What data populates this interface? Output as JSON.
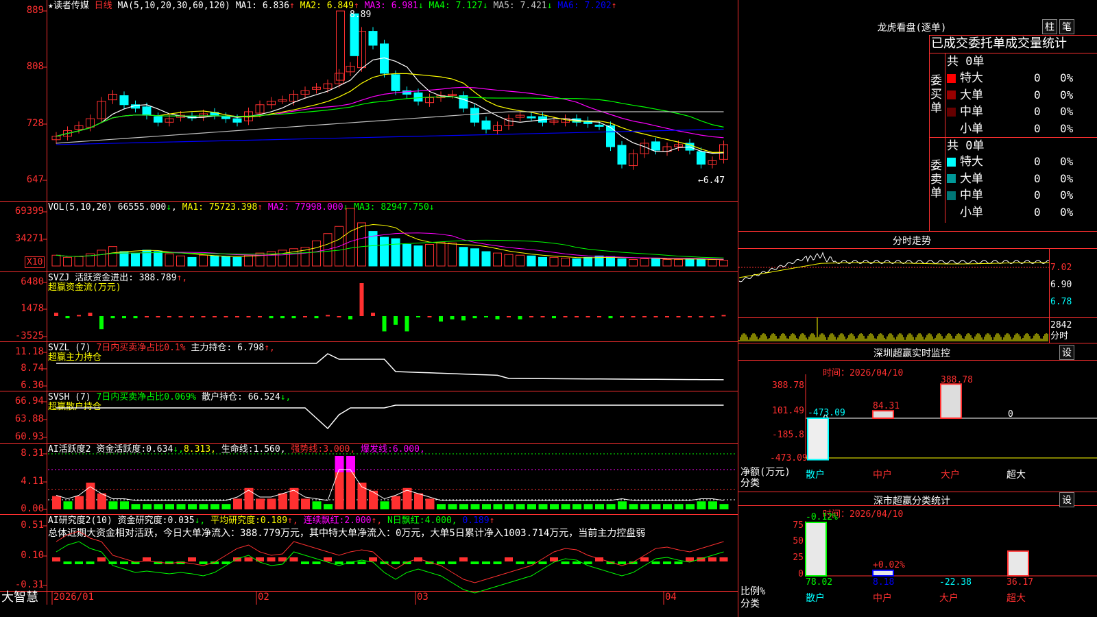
{
  "main": {
    "title": "★读者传媒",
    "period": "日线",
    "ma_label": "MA(5,10,20,30,60,120)",
    "ma": [
      {
        "label": "MA1:",
        "value": "6.836",
        "arrow": "↑",
        "color": "#ffffff"
      },
      {
        "label": "MA2:",
        "value": "6.849",
        "arrow": "↑",
        "color": "#ffff00"
      },
      {
        "label": "MA3:",
        "value": "6.981",
        "arrow": "↓",
        "color": "#ff00ff"
      },
      {
        "label": "MA4:",
        "value": "7.127",
        "arrow": "↓",
        "color": "#00ff00"
      },
      {
        "label": "MA5:",
        "value": "7.421",
        "arrow": "↓",
        "color": "#c0c0c0"
      },
      {
        "label": "MA6:",
        "value": "7.202",
        "arrow": "↑",
        "color": "#0000ff"
      }
    ],
    "yaxis": [
      "889",
      "808",
      "728",
      "647"
    ],
    "high_note": "8.89",
    "low_note": "←6.47"
  },
  "vol": {
    "label": "VOL(5,10,20)",
    "v0": "66555.000",
    "v0_arrow": "↓",
    "ma": [
      {
        "label": "MA1:",
        "value": "75723.398",
        "arrow": "↑",
        "color": "#ffff00"
      },
      {
        "label": "MA2:",
        "value": "77998.000",
        "arrow": "↓",
        "color": "#ff00ff"
      },
      {
        "label": "MA3:",
        "value": "82947.750",
        "arrow": "↓",
        "color": "#00ff00"
      }
    ],
    "yaxis": [
      "69399",
      "34271"
    ],
    "unit": "X10"
  },
  "svzj": {
    "label": "SVZJ",
    "line1": "活跃资金进出:",
    "val1": "388.789",
    "arrow1": "↑,",
    "line2": "超赢资金流(万元)",
    "yaxis": [
      "6480",
      "1478",
      "-3525"
    ]
  },
  "svzl": {
    "label": "SVZL (7)",
    "desc": "7日内买卖净占比0.1%",
    "line1": "主力持仓:",
    "val1": "6.798",
    "arrow1": "↑,",
    "line2": "超赢主力持仓",
    "yaxis": [
      "11.18",
      "8.74",
      "6.30"
    ]
  },
  "svsh": {
    "label": "SVSH (7)",
    "desc": "7日内买卖净占比0.069%",
    "line1": "散户持仓:",
    "val1": "66.524",
    "arrow1": "↓,",
    "line2": "超赢散户持仓",
    "yaxis": [
      "66.94",
      "63.88",
      "60.93"
    ]
  },
  "ai1": {
    "label": "AI活跃度2",
    "p1": "资金活跃度:",
    "v1": "0.634",
    "a1": "↓,",
    "v2": "8.313,",
    "p3": "生命线:",
    "v3": "1.560,",
    "p4": "强势线:",
    "v4": "3.000,",
    "p5": "爆发线:",
    "v5": "6.000,",
    "yaxis": [
      "8.31",
      "4.11",
      "0.00"
    ]
  },
  "ai2": {
    "label": "AI研究度2(10)",
    "p1": "资金研究度:",
    "v1": "0.035",
    "a1": "↓,",
    "p2": "平均研究度:",
    "v2": "0.189",
    "a2": "↑,",
    "p3": "连续飘红:",
    "v3": "2.000",
    "a3": "↑,",
    "p4": "N日飘红:",
    "v4": "4.000,",
    "v5": "0.189",
    "a5": "↑",
    "summary": "总体近期大资金相对活跃，今日大单净流入：388.779万元，其中特大单净流入：0万元，大单5日累计净入1003.714万元，当前主力控盘弱",
    "yaxis": [
      "0.51",
      "0.10",
      "-0.31"
    ]
  },
  "bottom": {
    "brand": "大智慧",
    "dates": [
      "2026/01",
      "02",
      "03",
      "04"
    ]
  },
  "lhkp": {
    "title": "龙虎看盘(逐单)",
    "btn1": "柱",
    "btn2": "笔",
    "subtitle": "已成交委托单成交量统计",
    "buy_label": "委买单",
    "sell_label": "委卖单",
    "buy_total": "共 0单",
    "sell_total": "共 0单",
    "buy_rows": [
      {
        "name": "特大",
        "n": "0",
        "p": "0%",
        "color": "#ff0000"
      },
      {
        "name": "大单",
        "n": "0",
        "p": "0%",
        "color": "#990000"
      },
      {
        "name": "中单",
        "n": "0",
        "p": "0%",
        "color": "#660000"
      },
      {
        "name": "小单",
        "n": "0",
        "p": "0%",
        "color": ""
      }
    ],
    "sell_rows": [
      {
        "name": "特大",
        "n": "0",
        "p": "0%",
        "color": "#00ffff"
      },
      {
        "name": "大单",
        "n": "0",
        "p": "0%",
        "color": "#009999"
      },
      {
        "name": "中单",
        "n": "0",
        "p": "0%",
        "color": "#007777"
      },
      {
        "name": "小单",
        "n": "0",
        "p": "0%",
        "color": ""
      }
    ]
  },
  "fenshi": {
    "title": "分时走势",
    "yaxis": [
      "7.02",
      "6.90",
      "6.78"
    ],
    "vol_top": "2842",
    "vol_unit": "分时"
  },
  "sz_monitor": {
    "title": "深圳超赢实时监控",
    "btn": "设",
    "time_label": "时间：2026/04/10",
    "yaxis": [
      "388.78",
      "101.49",
      "0",
      "-185.8",
      "-473.09"
    ],
    "value_labels": [
      "-473.09",
      "84.31",
      "388.78",
      "0"
    ],
    "ylabel1": "净额(万元)",
    "ylabel2": "分类",
    "categories": [
      "散户",
      "中户",
      "大户",
      "超大"
    ]
  },
  "sz_class": {
    "title": "深市超赢分类统计",
    "btn": "设",
    "time_label": "时间：2026/04/10",
    "yaxis": [
      "75",
      "50",
      "25",
      "0"
    ],
    "top_labels": [
      "-0.12%",
      "+0.02%"
    ],
    "bottom_values": [
      "78.02",
      "8.18",
      "-22.38",
      "36.17"
    ],
    "ylabel1": "比例%",
    "ylabel2": "分类",
    "categories": [
      "散户",
      "中户",
      "大户",
      "超大"
    ]
  }
}
